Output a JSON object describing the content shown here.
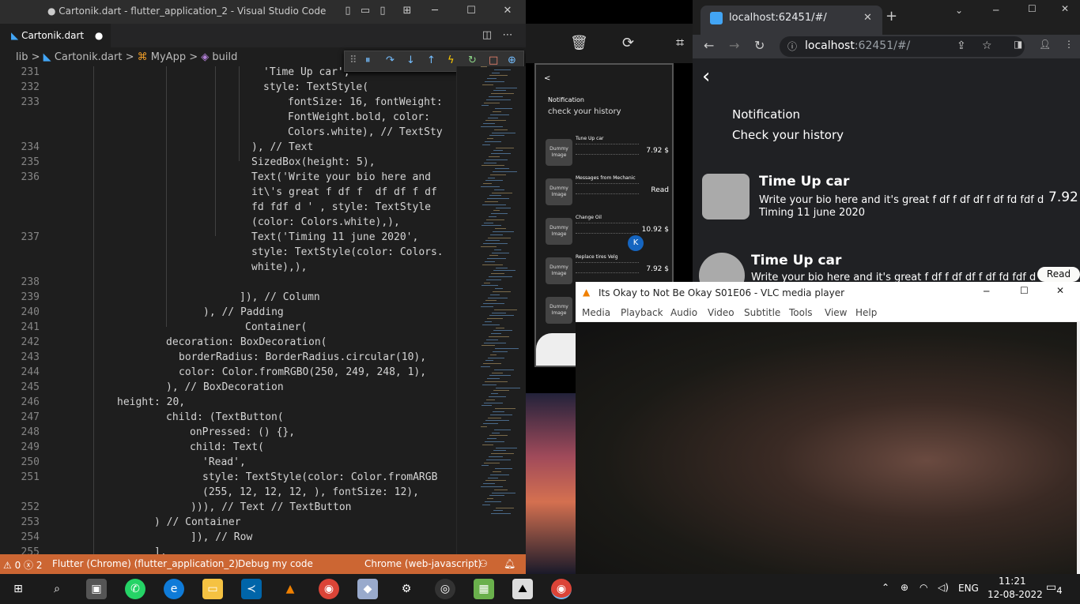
{
  "vscode": {
    "title": "● Cartonik.dart - flutter_application_2 - Visual Studio Code",
    "tab": "Cartonik.dart",
    "breadcrumb": [
      "lib",
      ">",
      "Cartonik.dart",
      ">",
      "MyApp",
      ">",
      "build"
    ],
    "lines": [
      {
        "n": "231",
        "t": "'Time Up car',"
      },
      {
        "n": "232",
        "t": "style: TextStyle("
      },
      {
        "n": "233",
        "t": "fontSize: 16, fontWeight:"
      },
      {
        "n": "",
        "t": "FontWeight.bold, color: "
      },
      {
        "n": "",
        "t": "Colors.white), // TextSty"
      },
      {
        "n": "234",
        "t": "), // Text"
      },
      {
        "n": "235",
        "t": "SizedBox(height: 5),"
      },
      {
        "n": "236",
        "t": "Text('Write your bio here and"
      },
      {
        "n": "",
        "t": "it\\'s great f df f  df df f df"
      },
      {
        "n": "",
        "t": "fd fdf d ' , style: TextStyle"
      },
      {
        "n": "",
        "t": "(color: Colors.white),),"
      },
      {
        "n": "237",
        "t": "Text('Timing 11 june 2020',"
      },
      {
        "n": "",
        "t": "style: TextStyle(color: Colors."
      },
      {
        "n": "",
        "t": "white),),"
      },
      {
        "n": "238",
        "t": ""
      },
      {
        "n": "239",
        "t": "]), // Column"
      },
      {
        "n": "240",
        "t": "), // Padding"
      },
      {
        "n": "241",
        "t": "Container("
      },
      {
        "n": "242",
        "t": "decoration: BoxDecoration("
      },
      {
        "n": "243",
        "t": "borderRadius: BorderRadius.circular(10),"
      },
      {
        "n": "244",
        "t": "color: Color.fromRGBO(250, 249, 248, 1),"
      },
      {
        "n": "245",
        "t": "), // BoxDecoration"
      },
      {
        "n": "246",
        "t": "height: 20,"
      },
      {
        "n": "247",
        "t": "child: (TextButton("
      },
      {
        "n": "248",
        "t": "onPressed: () {},"
      },
      {
        "n": "249",
        "t": "child: Text("
      },
      {
        "n": "250",
        "t": "'Read',"
      },
      {
        "n": "251",
        "t": "style: TextStyle(color: Color.fromARGB"
      },
      {
        "n": "",
        "t": "(255, 12, 12, 12, ), fontSize: 12),"
      },
      {
        "n": "252",
        "t": "))), // Text // TextButton"
      },
      {
        "n": "253",
        "t": ") // Container"
      },
      {
        "n": "254",
        "t": "]), // Row"
      },
      {
        "n": "255",
        "t": "],"
      }
    ],
    "status": {
      "problems": "⚠ 0 ⓧ 2",
      "target": "Flutter (Chrome) (flutter_application_2)",
      "debug": "Debug my code",
      "device": "Chrome (web-javascript)"
    }
  },
  "phone": {
    "back": "<",
    "title": "Notification",
    "subtitle": "check your history",
    "items": [
      {
        "img": "Dummy Image",
        "title": "Tune Up car",
        "price": "7.92 $"
      },
      {
        "img": "Dummy Image",
        "title": "Messages from Mechanic",
        "price": "Read"
      },
      {
        "img": "Dummy Image",
        "title": "Change Oil",
        "price": "10.92 $"
      },
      {
        "img": "Dummy Image",
        "title": "Replace tires Velg",
        "price": "7.92 $"
      },
      {
        "img": "Dummy Image",
        "title": "",
        "price": ""
      }
    ],
    "fab": "K"
  },
  "chrome": {
    "tab": "localhost:62451/#/",
    "url_host": "localhost",
    "url_rest": ":62451/#/",
    "back": "<",
    "heading": "Notification",
    "subheading": "Check your history",
    "card1": {
      "title": "Time Up car",
      "body": "Write your bio here and it's great f df f  df df f df fd fdf d",
      "timing": "Timing 11 june 2020",
      "price": "7.92"
    },
    "card2": {
      "title": "Time Up car",
      "body": "Write your bio here and it's great f df f  df df f df fd fdf d",
      "button": "Read"
    }
  },
  "vlc": {
    "title": "Its Okay to Not Be Okay S01E06 - VLC media player",
    "menu": [
      "Media",
      "Playback",
      "Audio",
      "Video",
      "Subtitle",
      "Tools",
      "View",
      "Help"
    ]
  },
  "taskbar": {
    "lang": "ENG",
    "time": "11:21",
    "date": "12-08-2022",
    "notif": "4"
  }
}
